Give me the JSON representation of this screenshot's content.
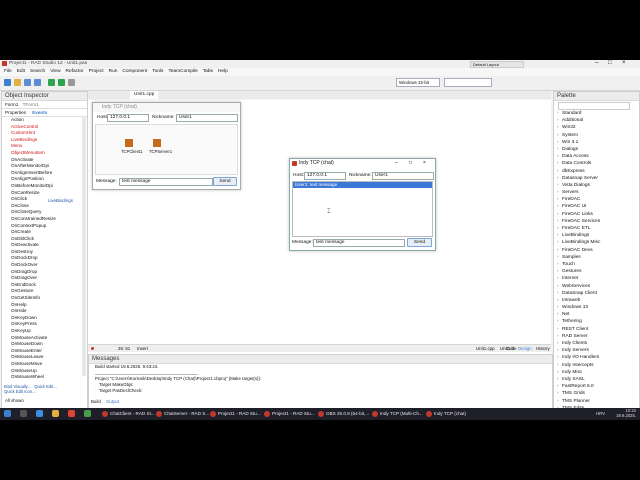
{
  "app": {
    "title": "Project1 - RAD Studio 12 - Unit1.pas",
    "platform": "Windows 32-bit",
    "platform_search": "Default Layout"
  },
  "menu": [
    "File",
    "Edit",
    "Search",
    "View",
    "Refactor",
    "Project",
    "Run",
    "Component",
    "Tools",
    "TeamCompile",
    "Tabs",
    "Help"
  ],
  "tabs": {
    "unit_tab": "Unit1.cpp"
  },
  "object_inspector": {
    "title": "Object Inspector",
    "selected": "Form1",
    "selected_type": "TForm1",
    "tab_properties": "Properties",
    "tab_events": "Events",
    "livebindings_value": "LiveBindings",
    "rows": [
      "Action",
      "ActiveControl",
      "CustomHint",
      "LiveBindings",
      "Menu",
      "ObjectMenuItem",
      "OnActivate",
      "OnAfterMonitorDpi",
      "OnAlignInsertBefore",
      "OnAlignPosition",
      "OnBeforeMonitorDpi",
      "OnCanResize",
      "OnClick",
      "OnClose",
      "OnCloseQuery",
      "OnConstrainedResize",
      "OnContextPopup",
      "OnCreate",
      "OnDblClick",
      "OnDeactivate",
      "OnDestroy",
      "OnDockDrop",
      "OnDockOver",
      "OnDragDrop",
      "OnDragOver",
      "OnEndDock",
      "OnGesture",
      "OnGetSiteInfo",
      "OnHelp",
      "OnHide",
      "OnKeyDown",
      "OnKeyPress",
      "OnKeyUp",
      "OnMouseActivate",
      "OnMouseDown",
      "OnMouseEnter",
      "OnMouseLeave",
      "OnMouseMove",
      "OnMouseUp",
      "OnMouseWheel"
    ],
    "red_rows": [
      1,
      2,
      3,
      4,
      5
    ],
    "footer_links": [
      "Bind Visually...",
      "Quick Edit...",
      "Quick Edit Icon..."
    ],
    "status": "All shown"
  },
  "designer_form": {
    "title": "Indy TCP (chat)",
    "host_label": "Host:",
    "host_value": "127.0.0.1",
    "nick_label": "Nickname:",
    "nick_value": "User1",
    "components": [
      "TCPClient1",
      "TCPServer1"
    ],
    "message_label": "Message:",
    "message_value": "test message",
    "send_label": "Send"
  },
  "running_window": {
    "title": "Indy TCP (chat)",
    "host_label": "Host:",
    "host_value": "127.0.0.1",
    "nick_label": "Nickname:",
    "nick_value": "User1",
    "chat_line": "User1: test message",
    "message_label": "Message:",
    "message_value": "test message",
    "send_label": "Send"
  },
  "editor_status": {
    "position": "26: 51",
    "mode": "Insert",
    "unit_tab": "Unit1.cpp",
    "unit_tab2": "Unit1.h",
    "code": "Code",
    "design": "Design",
    "history": "History"
  },
  "messages": {
    "title": "Messages",
    "lines": [
      "Build started 19.6.2025. 9:43:24.",
      "__________________________________________",
      "Project \"C:\\Users\\Korisnik\\Desktop\\Indy TCP (Chat)\\Project1.cbproj\" (Make target(s)):",
      "Target MakeObjs:",
      "Target PasDeclCheck:"
    ],
    "tab_build": "Build",
    "tab_output": "Output"
  },
  "palette": {
    "title": "Palette",
    "items": [
      "Standard",
      "Additional",
      "Win32",
      "System",
      "Win 3.1",
      "Dialogs",
      "Data Access",
      "Data Controls",
      "dbExpress",
      "Datasnap Server",
      "Vista Dialogs",
      "Servers",
      "FireDAC",
      "FireDAC UI",
      "FireDAC Links",
      "FireDAC Services",
      "FireDAC ETL",
      "LiveBindings",
      "LiveBindings Misc",
      "FireDAC Devs",
      "Samples",
      "Touch",
      "Gestures",
      "Internet",
      "WebServices",
      "DataSnap Client",
      "Intraweb",
      "Windows 10",
      "Net",
      "Tethering",
      "REST Client",
      "RAD Server",
      "Indy Clients",
      "Indy Servers",
      "Indy I/O Handlers",
      "Indy Intercepts",
      "Indy Misc",
      "Indy SASL",
      "FastReport 6.0",
      "TMS Grids",
      "TMS Planner",
      "TMS Edits"
    ]
  },
  "taskbar": {
    "apps": [
      "ChatClient - RAD St...",
      "ChatServer - RAD S...",
      "Project1 - RAD Stu...",
      "Project1 - RAD Stu...",
      "OBS 25.0.8 (64-bit,...",
      "Indy TCP (Multi-Ch...",
      "Indy TCP (chat)"
    ],
    "lang": "HRV",
    "time": "10:22",
    "date": "19.6.2025."
  },
  "colors": {
    "accent": "#3c7fd1",
    "selection": "#3b78d8",
    "taskbar": "#1f1f2a",
    "red_label": "#cc1111"
  }
}
